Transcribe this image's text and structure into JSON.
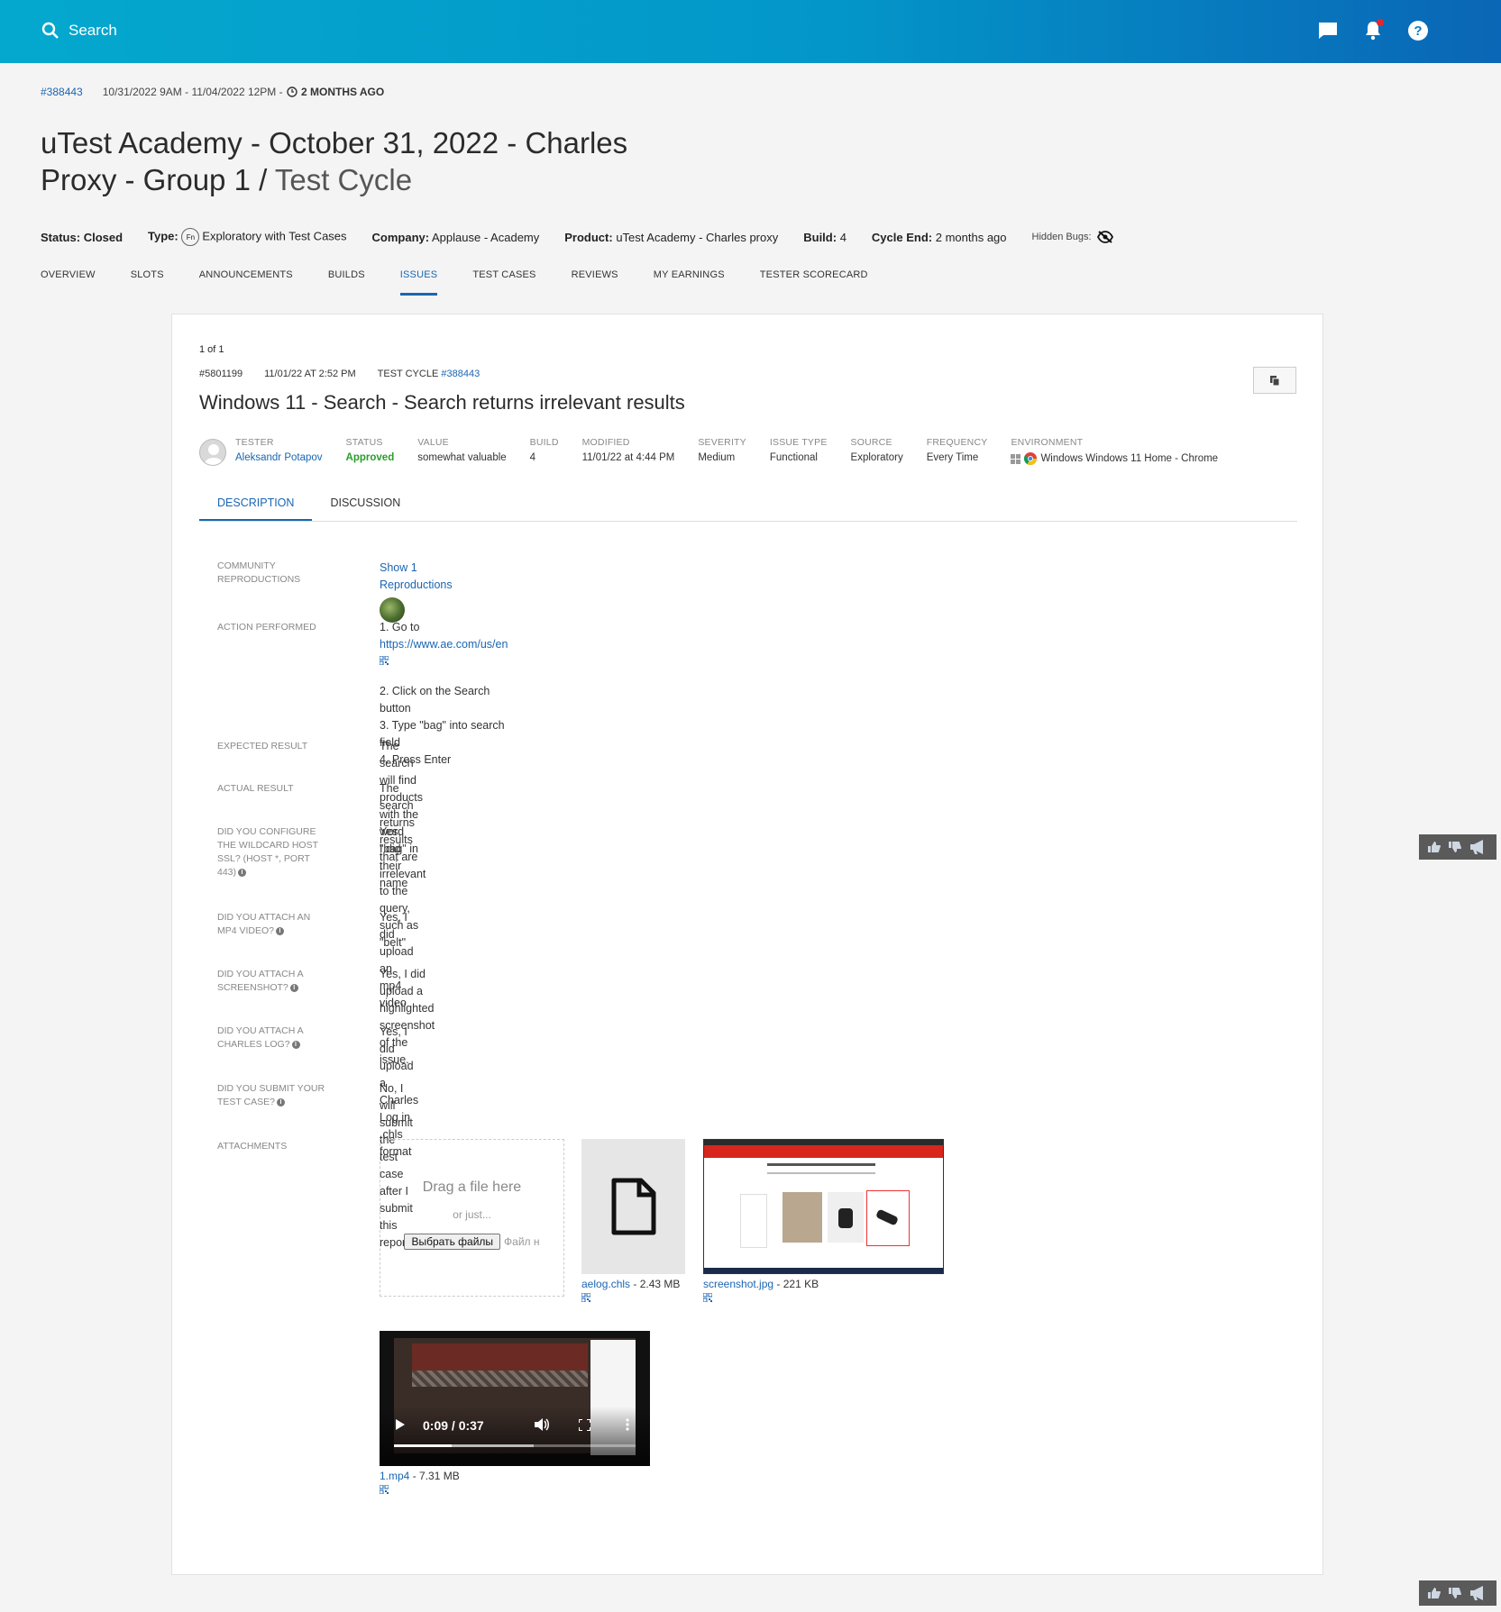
{
  "topbar": {
    "search_label": "Search"
  },
  "cycle": {
    "id": "#388443",
    "dates": "10/31/2022 9AM - 11/04/2022 12PM -",
    "ago": "2 MONTHS AGO",
    "title_main": "uTest Academy - October 31, 2022 - Charles Proxy - Group 1 /",
    "title_light": "Test Cycle"
  },
  "status_row": {
    "status_label": "Status:",
    "status_value": "Closed",
    "type_label": "Type:",
    "type_badge": "Fn",
    "type_value": "Exploratory with Test Cases",
    "company_label": "Company:",
    "company_value": "Applause - Academy",
    "product_label": "Product:",
    "product_value": "uTest Academy - Charles proxy",
    "build_label": "Build:",
    "build_value": "4",
    "cycle_end_label": "Cycle End:",
    "cycle_end_value": "2 months ago",
    "hidden_bugs_label": "Hidden Bugs:"
  },
  "nav_tabs": [
    "OVERVIEW",
    "SLOTS",
    "ANNOUNCEMENTS",
    "BUILDS",
    "ISSUES",
    "TEST CASES",
    "REVIEWS",
    "MY EARNINGS",
    "TESTER SCORECARD"
  ],
  "issue": {
    "pager": "1 of 1",
    "id": "#5801199",
    "created": "11/01/22 AT 2:52 PM",
    "test_cycle_label": "TEST CYCLE",
    "test_cycle_id": "#388443",
    "title": "Windows 11 - Search - Search returns irrelevant results",
    "props": {
      "tester_k": "TESTER",
      "tester_v": "Aleksandr Potapov",
      "status_k": "STATUS",
      "status_v": "Approved",
      "value_k": "VALUE",
      "value_v": "somewhat valuable",
      "build_k": "BUILD",
      "build_v": "4",
      "modified_k": "MODIFIED",
      "modified_v": "11/01/22 at 4:44 PM",
      "severity_k": "SEVERITY",
      "severity_v": "Medium",
      "issue_type_k": "ISSUE TYPE",
      "issue_type_v": "Functional",
      "source_k": "SOURCE",
      "source_v": "Exploratory",
      "frequency_k": "FREQUENCY",
      "frequency_v": "Every Time",
      "environment_k": "ENVIRONMENT",
      "environment_v": "Windows Windows 11 Home - Chrome"
    },
    "sub_tabs": [
      "DESCRIPTION",
      "DISCUSSION"
    ],
    "fields": {
      "community_label": "COMMUNITY REPRODUCTIONS",
      "community_link": "Show 1 Reproductions",
      "action_label": "ACTION PERFORMED",
      "action_step1_prefix": "1. Go to",
      "action_step1_link": "https://www.ae.com/us/en",
      "action_step2": "2. Click on the Search button",
      "action_step3": "3. Type \"bag\" into search field",
      "action_step4": "4. Press Enter",
      "expected_label": "EXPECTED RESULT",
      "expected_value": "The search will find products with the word \"bag\" in their name",
      "actual_label": "ACTUAL RESULT",
      "actual_value": "The search returns results that are irrelevant to the query, such as \"belt\"",
      "wildcard_label": "DID YOU CONFIGURE THE WILDCARD HOST SSL? (HOST *, PORT 443)",
      "wildcard_value": "Yes, I did",
      "mp4_label": "DID YOU ATTACH AN MP4 VIDEO?",
      "mp4_value": "Yes, I did upload an mp4 video",
      "screenshot_label": "DID YOU ATTACH A SCREENSHOT?",
      "screenshot_value": "Yes, I did upload a highlighted screenshot of the issue.",
      "charles_label": "DID YOU ATTACH A CHARLES LOG?",
      "charles_value": "Yes, I did upload a Charles Log in .chls format",
      "testcase_label": "DID YOU SUBMIT YOUR TEST CASE?",
      "testcase_value": "No, I will submit the test case after I submit this report",
      "attachments_label": "ATTACHMENTS"
    },
    "dropzone": {
      "title": "Drag a file here",
      "or": "or just...",
      "button": "Выбрать файлы",
      "no_file": "Файл н"
    },
    "attachments": {
      "chls_name": "aelog.chls",
      "chls_size": "- 2.43 MB",
      "jpg_name": "screenshot.jpg",
      "jpg_size": "- 221 KB",
      "mp4_name": "1.mp4",
      "mp4_size": "- 7.31 MB",
      "video_time": "0:09 / 0:37",
      "video_progress": 0.24
    }
  },
  "colors": {
    "brand": "#04a8ce",
    "link": "#1a66b3",
    "approved": "#2a9d2a"
  }
}
